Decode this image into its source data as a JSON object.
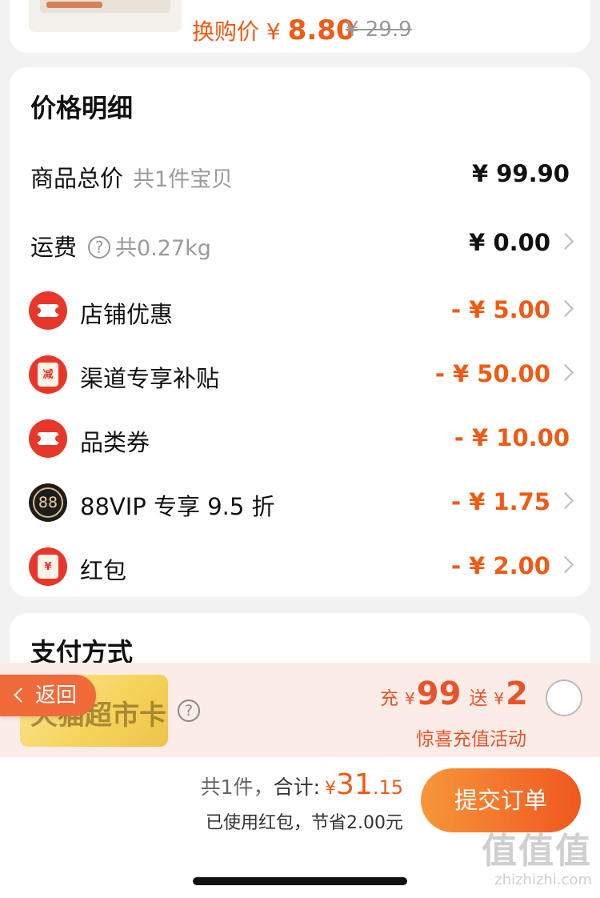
{
  "product": {
    "swap_label": "换购价",
    "swap_yen": "¥",
    "swap_price": "8.80",
    "original_price": "¥ 29.9"
  },
  "price_detail": {
    "title": "价格明细",
    "goods_total": {
      "label": "商品总价",
      "sub": "共1件宝贝",
      "value": "¥ 99.90"
    },
    "shipping": {
      "label": "运费",
      "help": "?",
      "sub": "共0.27kg",
      "value": "¥ 0.00"
    },
    "discounts": [
      {
        "icon": "ticket-icon",
        "label": "店铺优惠",
        "value": "- ¥ 5.00",
        "has_arrow": true
      },
      {
        "icon": "envelope-icon",
        "badge_text": "减",
        "label": "渠道专享补贴",
        "value": "- ¥ 50.00",
        "has_arrow": true
      },
      {
        "icon": "ticket-icon",
        "label": "品类券",
        "value": "- ¥ 10.00",
        "has_arrow": false
      },
      {
        "icon": "vip-88-icon",
        "badge_text": "88",
        "label": "88VIP 专享 9.5 折",
        "value": "- ¥ 1.75",
        "has_arrow": true
      },
      {
        "icon": "red-packet-icon",
        "badge_text": "¥",
        "label": "红包",
        "value": "- ¥ 2.00",
        "has_arrow": true
      }
    ]
  },
  "payment": {
    "title": "支付方式",
    "card_name": "天猫超市卡",
    "help": "?",
    "promo": {
      "charge_label": "充",
      "charge_yen": "¥",
      "charge_amount": "99",
      "gift_label": "送",
      "gift_yen": "¥",
      "gift_amount": "2",
      "subtitle": "惊喜充值活动"
    }
  },
  "back_button": {
    "label": "返回"
  },
  "footer": {
    "count": "共1件，",
    "total_label": "合计:",
    "yen": "¥",
    "total_int": "31",
    "total_dec": ".15",
    "saved": "已使用红包，节省2.00元",
    "submit": "提交订单"
  },
  "watermark": {
    "logo": "值值值",
    "site": "zhizhizhi.com"
  },
  "colors": {
    "accent": "#f05a14",
    "badge_red": "#e8372a",
    "button_start": "#f7963a",
    "button_end": "#f0571f",
    "promo_bg": "#fcece7"
  }
}
